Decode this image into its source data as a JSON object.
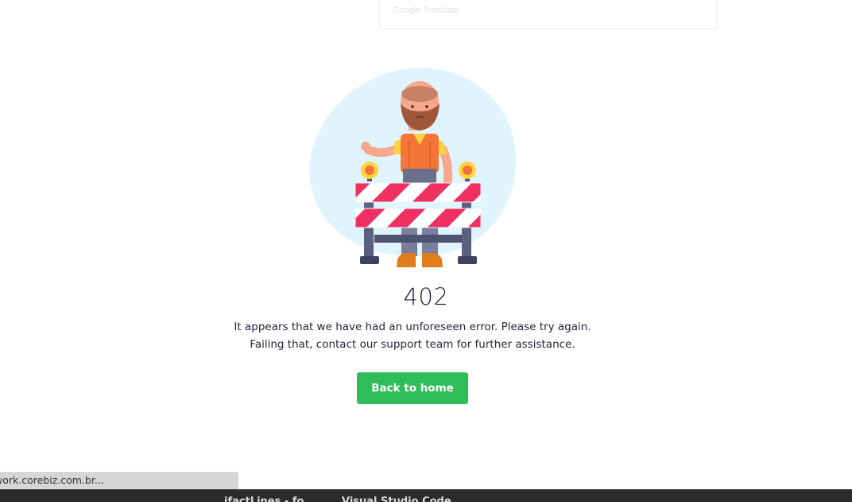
{
  "translate_widget": {
    "label": "Google Translate"
  },
  "error": {
    "code": "402",
    "message": "It appears that we have had an unforeseen error. Please try again. Failing that, contact our support team for further assistance.",
    "button_label": "Back to home"
  },
  "status_bar": {
    "url": "work.corebiz.com.br..."
  },
  "taskbar": {
    "items": [
      "ifactLines - fo",
      "Visual Studio Code"
    ]
  },
  "colors": {
    "accent": "#2ebd59",
    "blob": "#dff4fd",
    "stripe_red": "#ee3063",
    "vest": "#f57438"
  }
}
